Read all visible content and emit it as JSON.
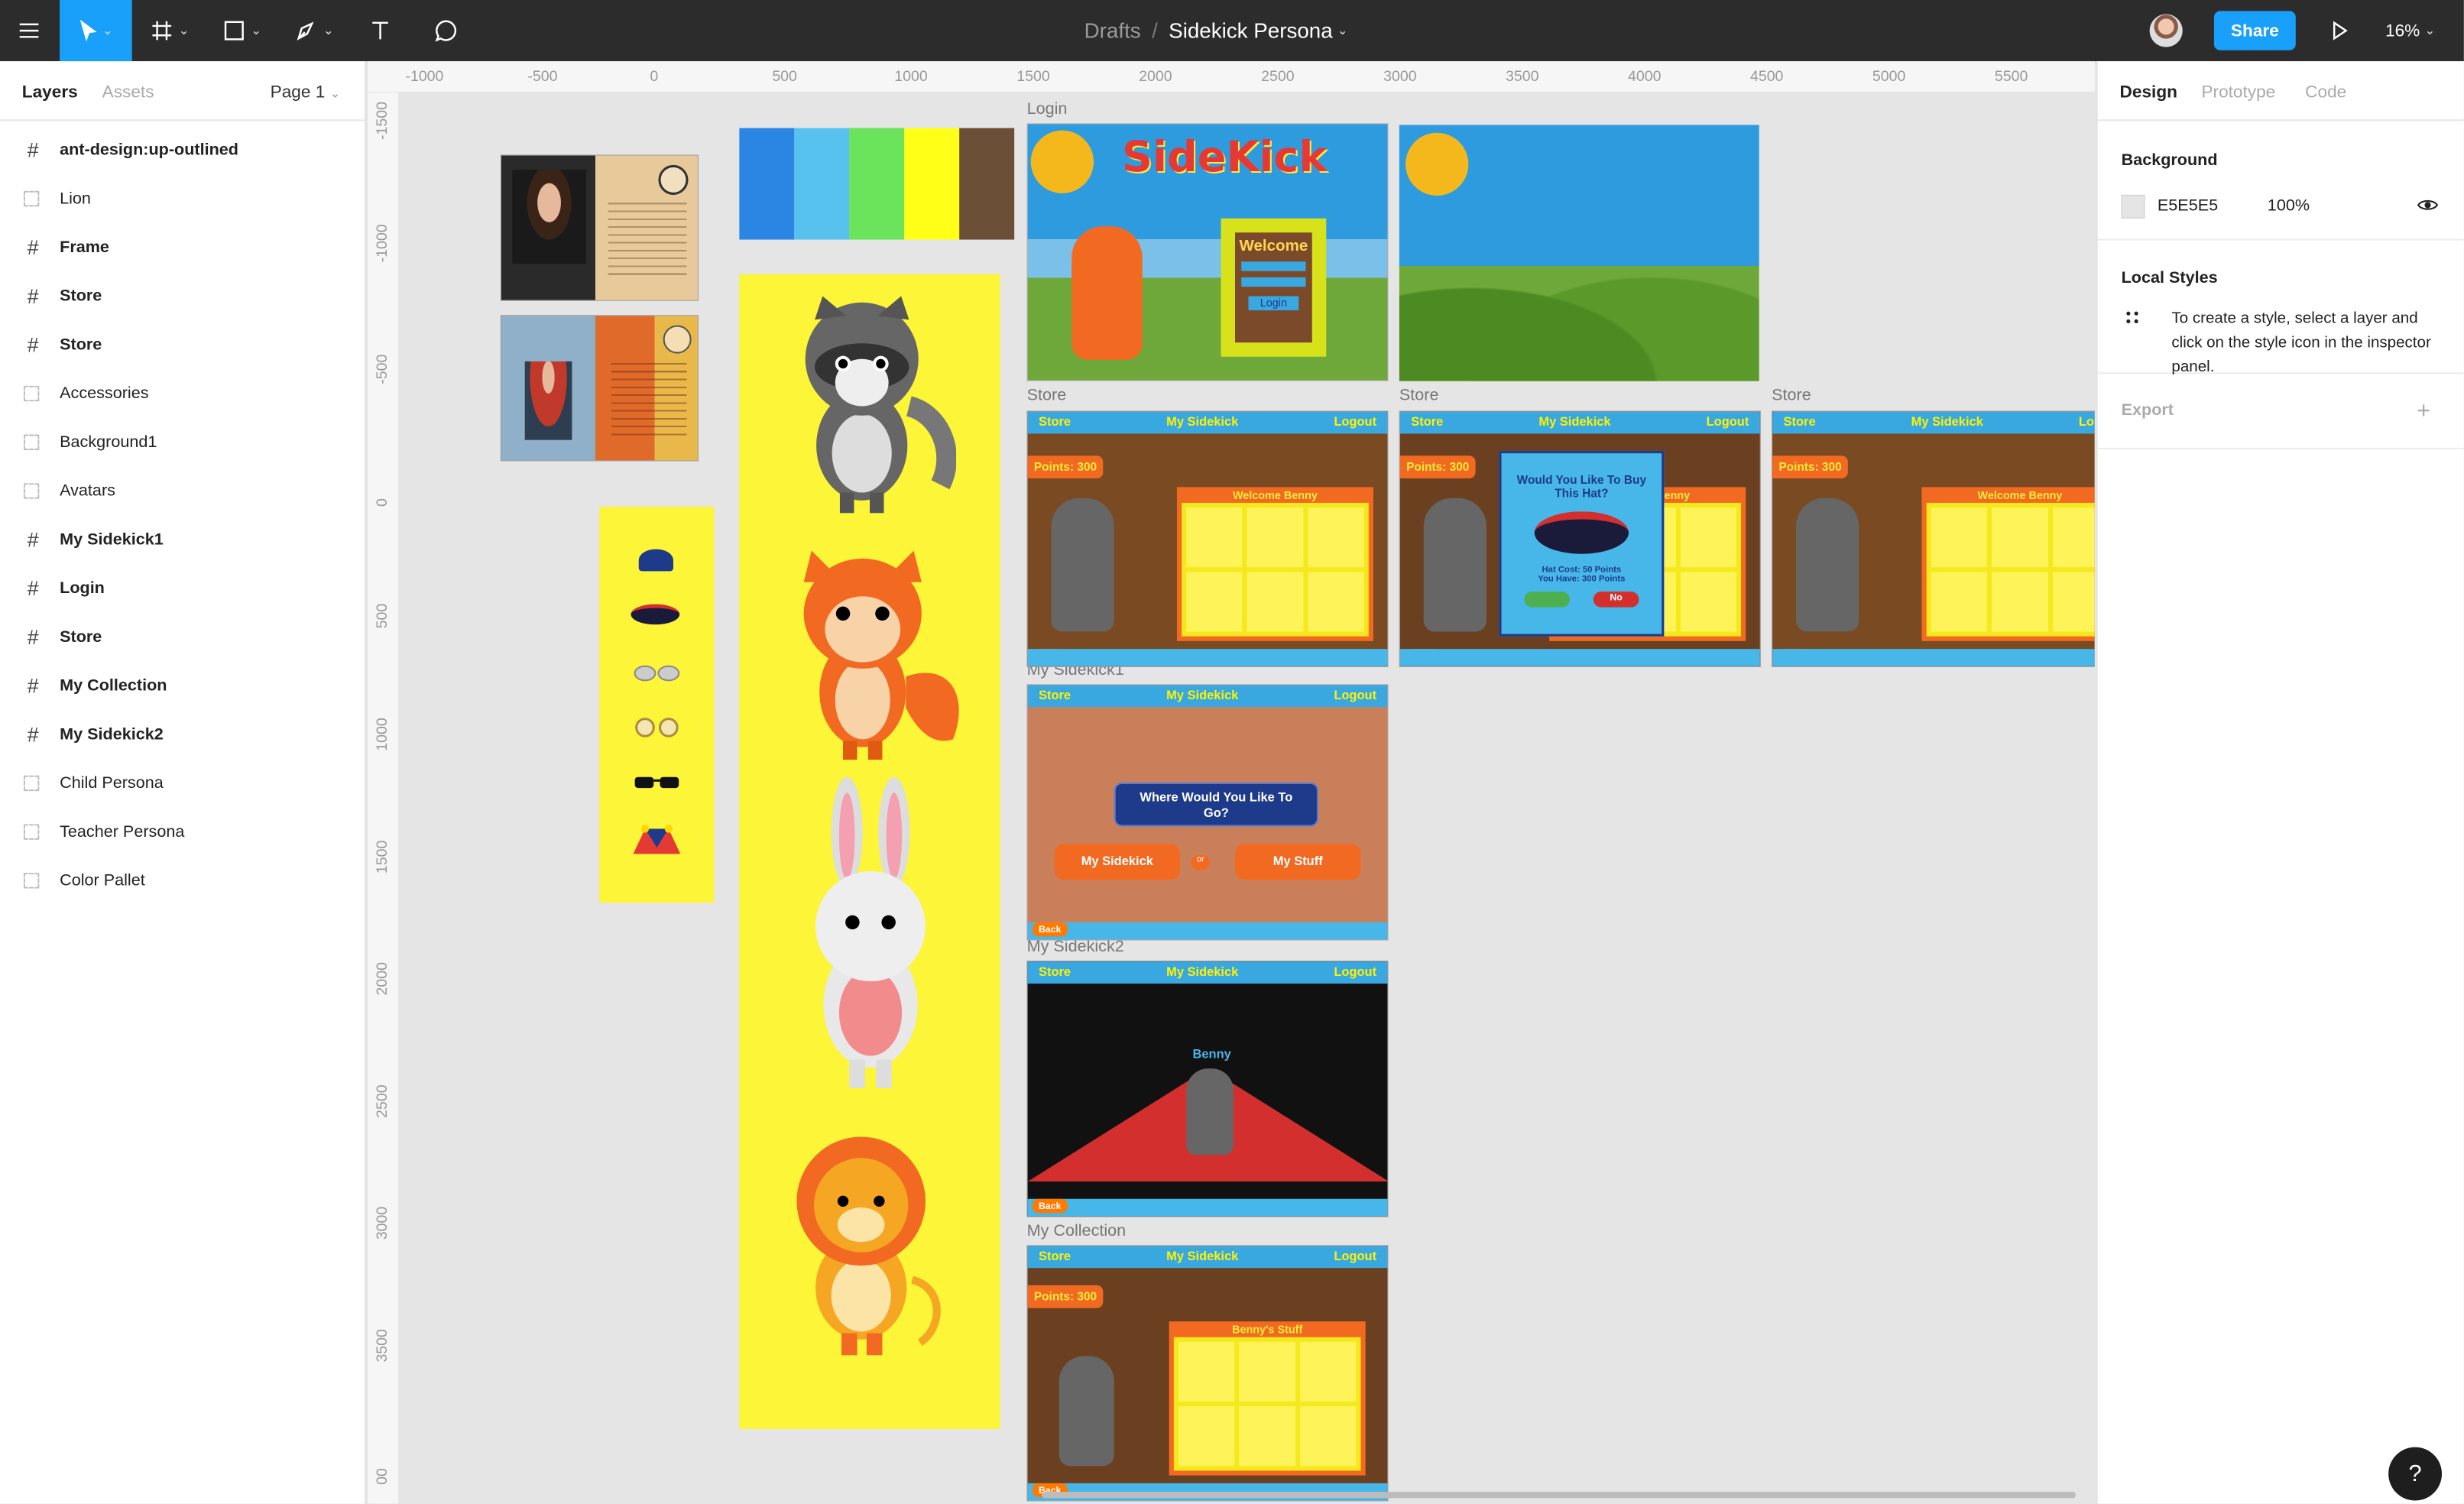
{
  "toolbar": {
    "breadcrumb_parent": "Drafts",
    "breadcrumb_sep": "/",
    "file_name": "Sidekick Persona",
    "share_label": "Share",
    "zoom": "16%"
  },
  "left_panel": {
    "tab_layers": "Layers",
    "tab_assets": "Assets",
    "page": "Page 1",
    "layers": [
      {
        "name": "ant-design:up-outlined",
        "type": "frame"
      },
      {
        "name": "Lion",
        "type": "group"
      },
      {
        "name": "Frame",
        "type": "frame"
      },
      {
        "name": "Store",
        "type": "frame"
      },
      {
        "name": "Store",
        "type": "frame"
      },
      {
        "name": "Accessories",
        "type": "group"
      },
      {
        "name": "Background1",
        "type": "group"
      },
      {
        "name": "Avatars",
        "type": "group"
      },
      {
        "name": "My Sidekick1",
        "type": "frame"
      },
      {
        "name": "Login",
        "type": "frame"
      },
      {
        "name": "Store",
        "type": "frame"
      },
      {
        "name": "My Collection",
        "type": "frame"
      },
      {
        "name": "My Sidekick2",
        "type": "frame"
      },
      {
        "name": "Child Persona",
        "type": "group"
      },
      {
        "name": "Teacher Persona",
        "type": "group"
      },
      {
        "name": "Color Pallet",
        "type": "group"
      }
    ]
  },
  "right_panel": {
    "tab_design": "Design",
    "tab_prototype": "Prototype",
    "tab_code": "Code",
    "background_title": "Background",
    "background_hex": "E5E5E5",
    "background_opacity": "100%",
    "local_styles_title": "Local Styles",
    "local_styles_text": "To create a style, select a layer and click on the style icon in the inspector panel.",
    "export_title": "Export"
  },
  "rulers": {
    "h_ticks": [
      "-1000",
      "-500",
      "0",
      "500",
      "1000",
      "1500",
      "2000",
      "2500",
      "3000",
      "3500",
      "4000",
      "4500",
      "5000",
      "5500"
    ],
    "v_ticks": [
      "-1500",
      "-1000",
      "-500",
      "0",
      "500",
      "1000",
      "1500",
      "2000",
      "2500",
      "3000",
      "3500",
      "00"
    ]
  },
  "canvas": {
    "frame_labels": {
      "login": "Login",
      "store1": "Store",
      "store2": "Store",
      "store3": "Store",
      "sidekick1": "My Sidekick1",
      "sidekick2": "My Sidekick2",
      "collection": "My Collection"
    },
    "palette": [
      "#2b86e3",
      "#58c2ee",
      "#6be35a",
      "#ffff17",
      "#6b4f37"
    ],
    "screen_text": {
      "store": "Store",
      "my_sidekick": "My Sidekick",
      "logout": "Logout",
      "points": "Points: 300",
      "welcome": "Welcome Benny",
      "back": "Back",
      "login_logo": "SideKick",
      "login_welcome": "Welcome",
      "login_button": "Login",
      "buy_question": "Would You Like To Buy This Hat?",
      "buy_cost": "Hat Cost: 50 Points",
      "buy_have": "You Have: 300 Points",
      "no": "No",
      "where_go": "Where Would You Like To Go?",
      "or": "or",
      "my_stuff": "My Stuff",
      "benny": "Benny",
      "bennys_stuff": "Benny's Stuff",
      "item_hat": "Hat",
      "item_glasses": "Glasses",
      "item_points": "50 Points"
    }
  },
  "help_label": "?"
}
